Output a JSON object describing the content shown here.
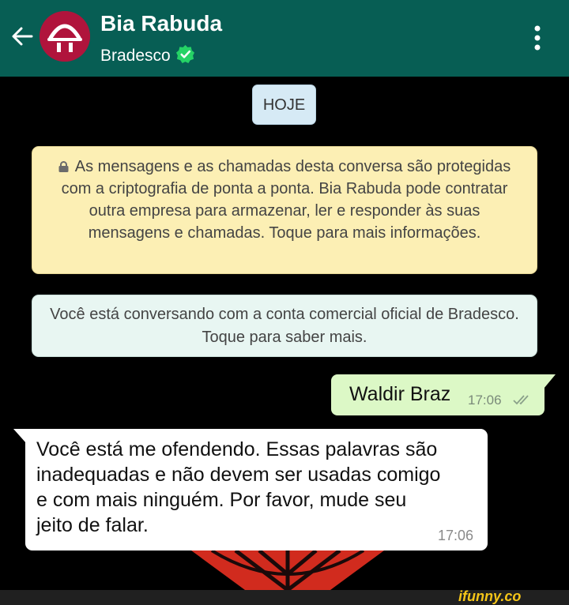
{
  "header": {
    "title": "Bia Rabuda",
    "subtitle": "Bradesco",
    "accent": "#075e54"
  },
  "chat": {
    "day_label": "HOJE",
    "encryption_notice": "As mensagens e as chamadas desta conversa são protegidas com a criptografia de ponta a ponta. Bia Rabuda pode contratar outra empresa para armazenar, ler e responder às suas mensagens e chamadas. Toque para mais informações.",
    "business_notice": "Você está conversando com a conta comercial oficial de Bradesco. Toque para saber mais.",
    "messages": [
      {
        "direction": "outgoing",
        "text": "Waldir Braz",
        "time": "17:06",
        "status": "read"
      },
      {
        "direction": "incoming",
        "text": "Você está me ofendendo. Essas palavras são inadequadas e não devem ser usadas comigo e com mais ninguém. Por favor, mude seu jeito de falar.",
        "time": "17:06"
      }
    ]
  },
  "watermark": "ifunny.co"
}
